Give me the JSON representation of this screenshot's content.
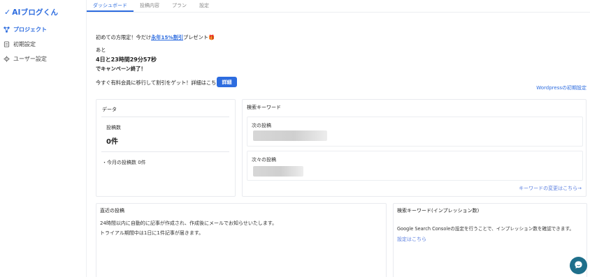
{
  "app": {
    "logo_text": "AIブログくん"
  },
  "sidebar": {
    "items": [
      {
        "label": "プロジェクト",
        "icon": "project-icon"
      },
      {
        "label": "初期設定",
        "icon": "document-icon"
      },
      {
        "label": "ユーザー設定",
        "icon": "gear-icon"
      }
    ]
  },
  "tabs": [
    {
      "label": "ダッシュボード"
    },
    {
      "label": "投稿内容"
    },
    {
      "label": "プラン"
    },
    {
      "label": "設定"
    }
  ],
  "campaign": {
    "line1_prefix": "初めての方限定！今だけ",
    "line1_link": "永年15%割引",
    "line1_suffix": "プレゼント🎁",
    "line2": "あと",
    "countdown": "4日と23時間29分57秒",
    "line3": "でキャンペーン終了！",
    "cta_text": "今すぐ有料会員に移行して割引をゲット！詳細はこちら👉",
    "detail_button": "詳細"
  },
  "wordpress_link": "Wordpressの初期設定",
  "data_card": {
    "title": "データ",
    "posts_label": "投稿数",
    "posts_value": "0件",
    "monthly": "・今月の投稿数 0件"
  },
  "keyword_card": {
    "title": "検索キーワード",
    "next_label": "次の投稿",
    "after_next_label": "次々の投稿",
    "change_link": "キーワードの変更はこちら→"
  },
  "recent_card": {
    "title": "直近の投稿",
    "line1": "24時間以内に自動的に記事が作成され、作成後にメールでお知らせいたします。",
    "line2": "トライアル期間中は1日に1件記事が届きます。"
  },
  "impression_card": {
    "title": "検索キーワード(インプレッション数)",
    "desc": "Google Search Consoleの設定を行うことで、インプレッション数を確認できます。",
    "link": "設定はこちら"
  },
  "colors": {
    "accent": "#2d6cdf",
    "chat": "#1f6f8b"
  }
}
